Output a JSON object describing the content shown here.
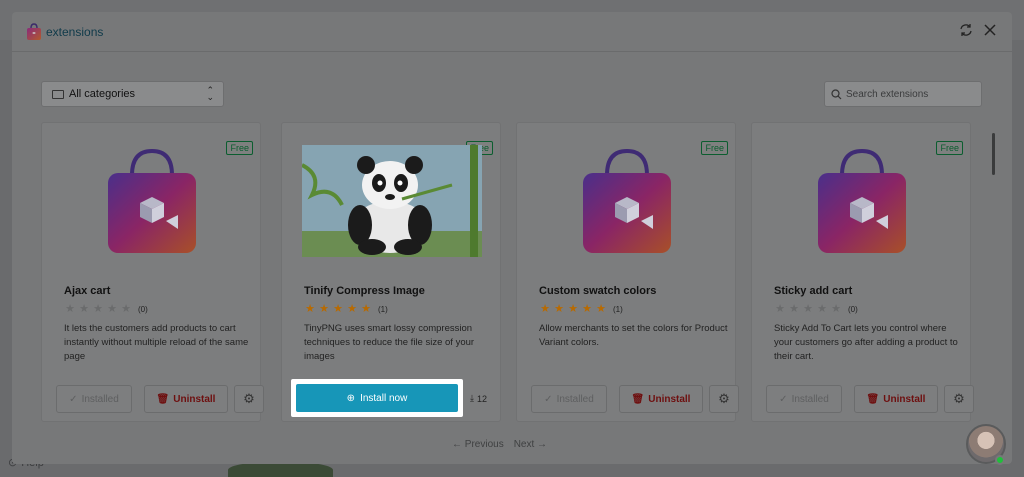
{
  "background": {
    "help_label": "Help"
  },
  "modal": {
    "title": "extensions",
    "refresh_icon": "refresh-icon",
    "close_icon": "close-icon"
  },
  "filters": {
    "category_value": "All categories",
    "search_placeholder": "Search extensions"
  },
  "cards": [
    {
      "name": "Ajax cart",
      "badge": "Free",
      "rating_count": "(0)",
      "stars_filled": 0,
      "description": "It lets the customers add products to cart instantly without multiple reload of the same page",
      "installed_label": "Installed",
      "uninstall_label": "Uninstall",
      "image": "shop-bag-logo"
    },
    {
      "name": "Tinify Compress Image",
      "badge": "Free",
      "rating_count": "(1)",
      "stars_filled": 5,
      "description": "TinyPNG uses smart lossy compression techniques to reduce the file size of your images",
      "install_label": "Install now",
      "downloads": "12",
      "image": "panda-illustration"
    },
    {
      "name": "Custom swatch colors",
      "badge": "Free",
      "rating_count": "(1)",
      "stars_filled": 5,
      "description": "Allow merchants to set the colors for Product Variant colors.",
      "installed_label": "Installed",
      "uninstall_label": "Uninstall",
      "image": "shop-bag-logo"
    },
    {
      "name": "Sticky add cart",
      "badge": "Free",
      "rating_count": "(0)",
      "stars_filled": 0,
      "description": "Sticky Add To Cart lets you control where your customers go after adding a product to their cart.",
      "installed_label": "Installed",
      "uninstall_label": "Uninstall",
      "image": "shop-bag-logo"
    }
  ],
  "pagination": {
    "previous_label": "Previous",
    "next_label": "Next"
  },
  "colors": {
    "accent": "#1796b8",
    "free_badge": "#0b5d2f",
    "star_filled": "#b86a00",
    "uninstall": "#6e0f0f"
  }
}
